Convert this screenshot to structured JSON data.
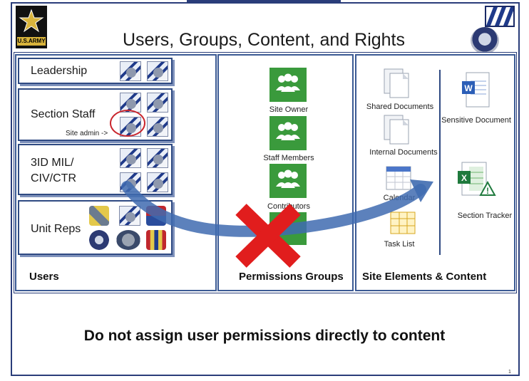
{
  "slide": {
    "title": "Users, Groups, Content, and Rights",
    "logo_text": "U.S.ARMY",
    "page_number": "1",
    "bottom_message": "Do not assign user permissions directly to content"
  },
  "columns": {
    "users": "Users",
    "permissions": "Permissions Groups",
    "site": "Site Elements &  Content"
  },
  "users": {
    "leadership": "Leadership",
    "section_staff": "Section Staff",
    "site_admin": "Site admin ->",
    "mil_line1": "3ID MIL/",
    "mil_line2": "CIV/CTR",
    "unit_reps": "Unit Reps"
  },
  "permission_groups": [
    "Site Owner",
    "Staff Members",
    "Contributors"
  ],
  "site_elements": {
    "shared_documents": "Shared Documents",
    "internal_documents": "Internal Documents",
    "calendar": "Calendar",
    "task_list": "Task List",
    "sensitive_document": "Sensitive Document",
    "section_tracker": "Section Tracker"
  },
  "colors": {
    "border": "#2a3d7a",
    "group_green": "#3a9a3c",
    "arrow_blue": "#3f6bb0",
    "cross_red": "#e11d1d",
    "admin_circle": "#c9252c"
  }
}
